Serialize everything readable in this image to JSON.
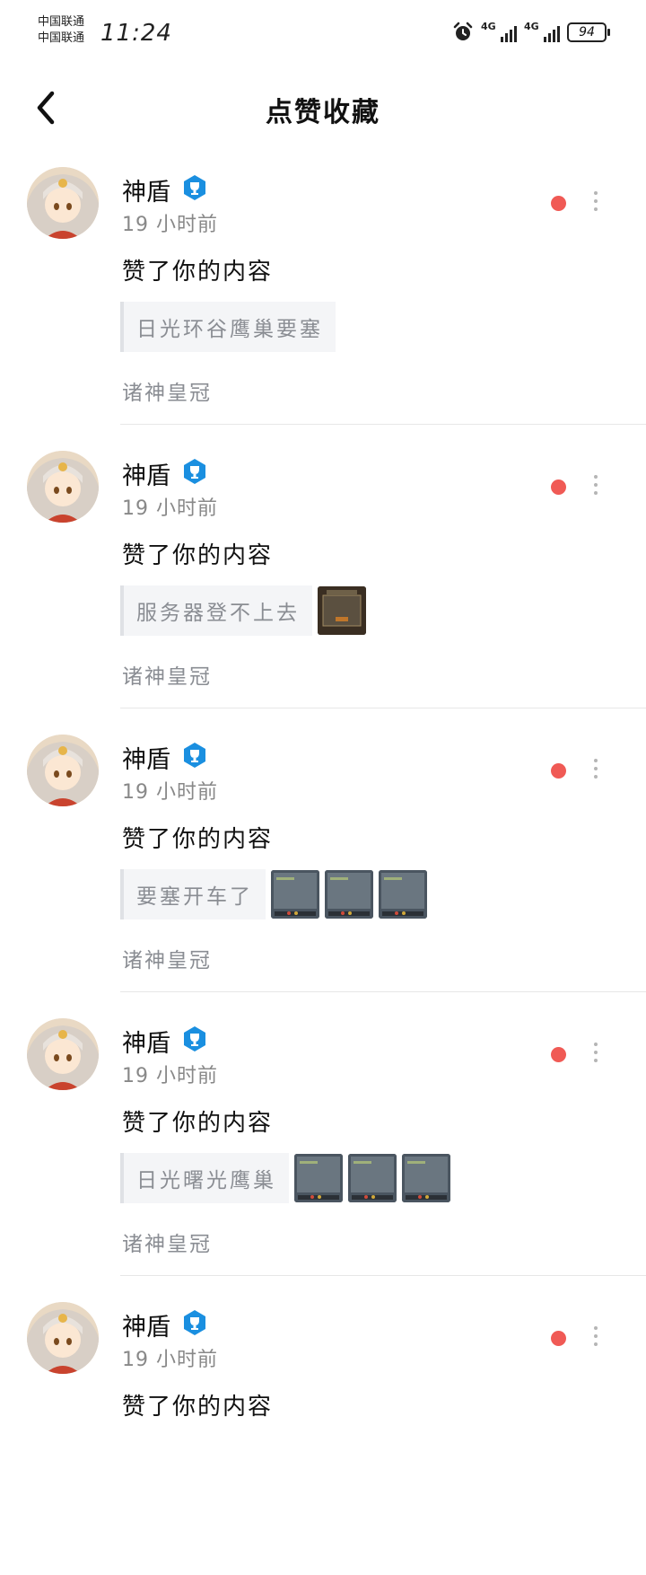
{
  "status": {
    "carrier1": "中国联通",
    "carrier2": "中国联通",
    "time": "11:24",
    "net1": "4G",
    "net2": "4G",
    "battery": "94"
  },
  "header": {
    "title": "点赞收藏"
  },
  "notifications": [
    {
      "username": "神盾",
      "time": "19 小时前",
      "action": "赞了你的内容",
      "post_title": "日光环谷鹰巢要塞",
      "thumbnails": 0,
      "community": "诸神皇冠"
    },
    {
      "username": "神盾",
      "time": "19 小时前",
      "action": "赞了你的内容",
      "post_title": "服务器登不上去",
      "thumbnails": 1,
      "community": "诸神皇冠"
    },
    {
      "username": "神盾",
      "time": "19 小时前",
      "action": "赞了你的内容",
      "post_title": "要塞开车了",
      "thumbnails": 3,
      "community": "诸神皇冠"
    },
    {
      "username": "神盾",
      "time": "19 小时前",
      "action": "赞了你的内容",
      "post_title": "日光曙光鹰巢",
      "thumbnails": 3,
      "community": "诸神皇冠"
    },
    {
      "username": "神盾",
      "time": "19 小时前",
      "action": "赞了你的内容",
      "post_title": "",
      "thumbnails": 0,
      "community": ""
    }
  ],
  "colors": {
    "unread_dot": "#f05a55",
    "badge_blue": "#1a8fe0",
    "secondary_text": "#8a8d93"
  }
}
